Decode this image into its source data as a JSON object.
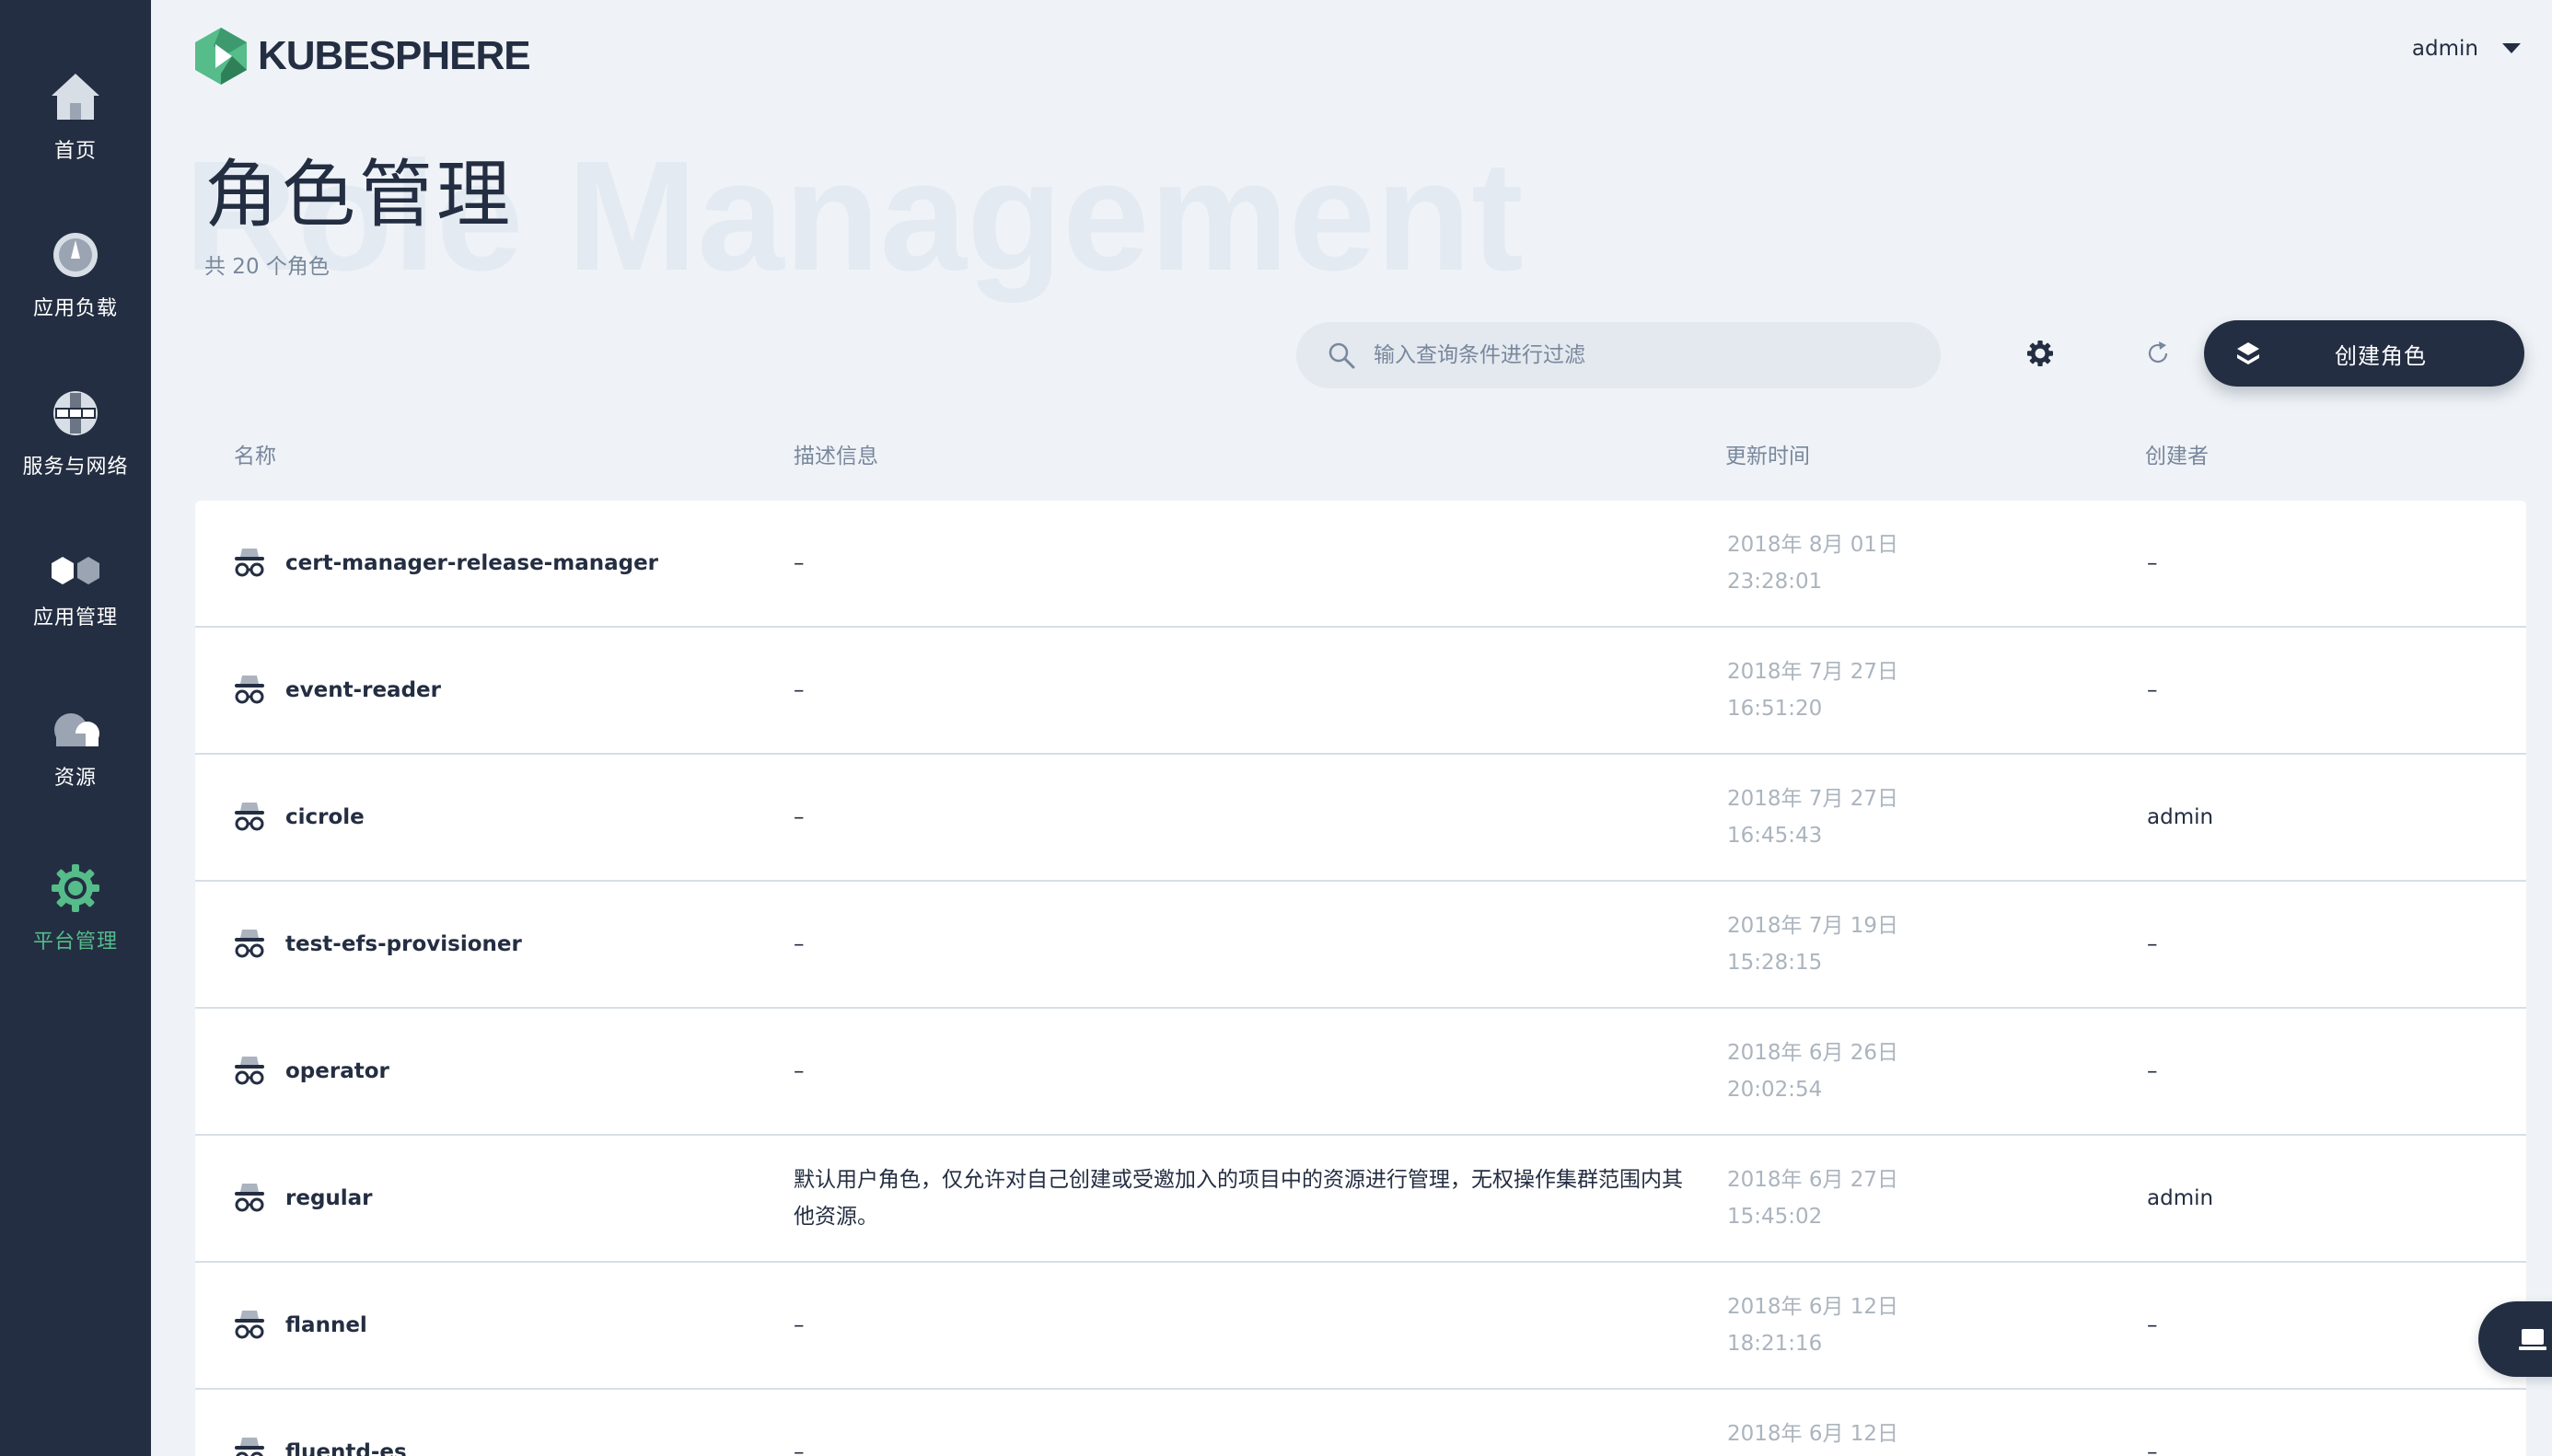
{
  "app": {
    "logo_text": "KUBESPHERE",
    "user": "admin"
  },
  "sidebar": {
    "items": [
      {
        "label": "首页",
        "icon": "home-icon",
        "active": false
      },
      {
        "label": "应用负载",
        "icon": "dashboard-icon",
        "active": false
      },
      {
        "label": "服务与网络",
        "icon": "network-icon",
        "active": false
      },
      {
        "label": "应用管理",
        "icon": "hexagons-icon",
        "active": false
      },
      {
        "label": "资源",
        "icon": "cloud-icon",
        "active": false
      },
      {
        "label": "平台管理",
        "icon": "gear-icon",
        "active": true
      }
    ]
  },
  "page": {
    "bg_title": "Role Management",
    "title": "角色管理",
    "subtitle": "共 20 个角色"
  },
  "toolbar": {
    "search_placeholder": "输入查询条件进行过滤",
    "create_label": "创建角色"
  },
  "table": {
    "headers": {
      "name": "名称",
      "desc": "描述信息",
      "time": "更新时间",
      "creator": "创建者"
    },
    "rows": [
      {
        "name": "cert-manager-release-manager",
        "desc": "–",
        "date": "2018年 8月 01日",
        "time": "23:28:01",
        "creator": "–"
      },
      {
        "name": "event-reader",
        "desc": "–",
        "date": "2018年 7月 27日",
        "time": "16:51:20",
        "creator": "–"
      },
      {
        "name": "cicrole",
        "desc": "–",
        "date": "2018年 7月 27日",
        "time": "16:45:43",
        "creator": "admin"
      },
      {
        "name": "test-efs-provisioner",
        "desc": "–",
        "date": "2018年 7月 19日",
        "time": "15:28:15",
        "creator": "–"
      },
      {
        "name": "operator",
        "desc": "–",
        "date": "2018年 6月 26日",
        "time": "20:02:54",
        "creator": "–"
      },
      {
        "name": "regular",
        "desc": "默认用户角色，仅允许对自己创建或受邀加入的项目中的资源进行管理，无权操作集群范围内其他资源。",
        "date": "2018年 6月 27日",
        "time": "15:45:02",
        "creator": "admin"
      },
      {
        "name": "flannel",
        "desc": "–",
        "date": "2018年 6月 12日",
        "time": "18:21:16",
        "creator": "–"
      },
      {
        "name": "fluentd-es",
        "desc": "–",
        "date": "2018年 6月 12日",
        "time": "",
        "creator": "–"
      }
    ]
  },
  "colors": {
    "sidebar_bg": "#242e42",
    "accent": "#55bc8a",
    "page_bg": "#eff3f7"
  }
}
